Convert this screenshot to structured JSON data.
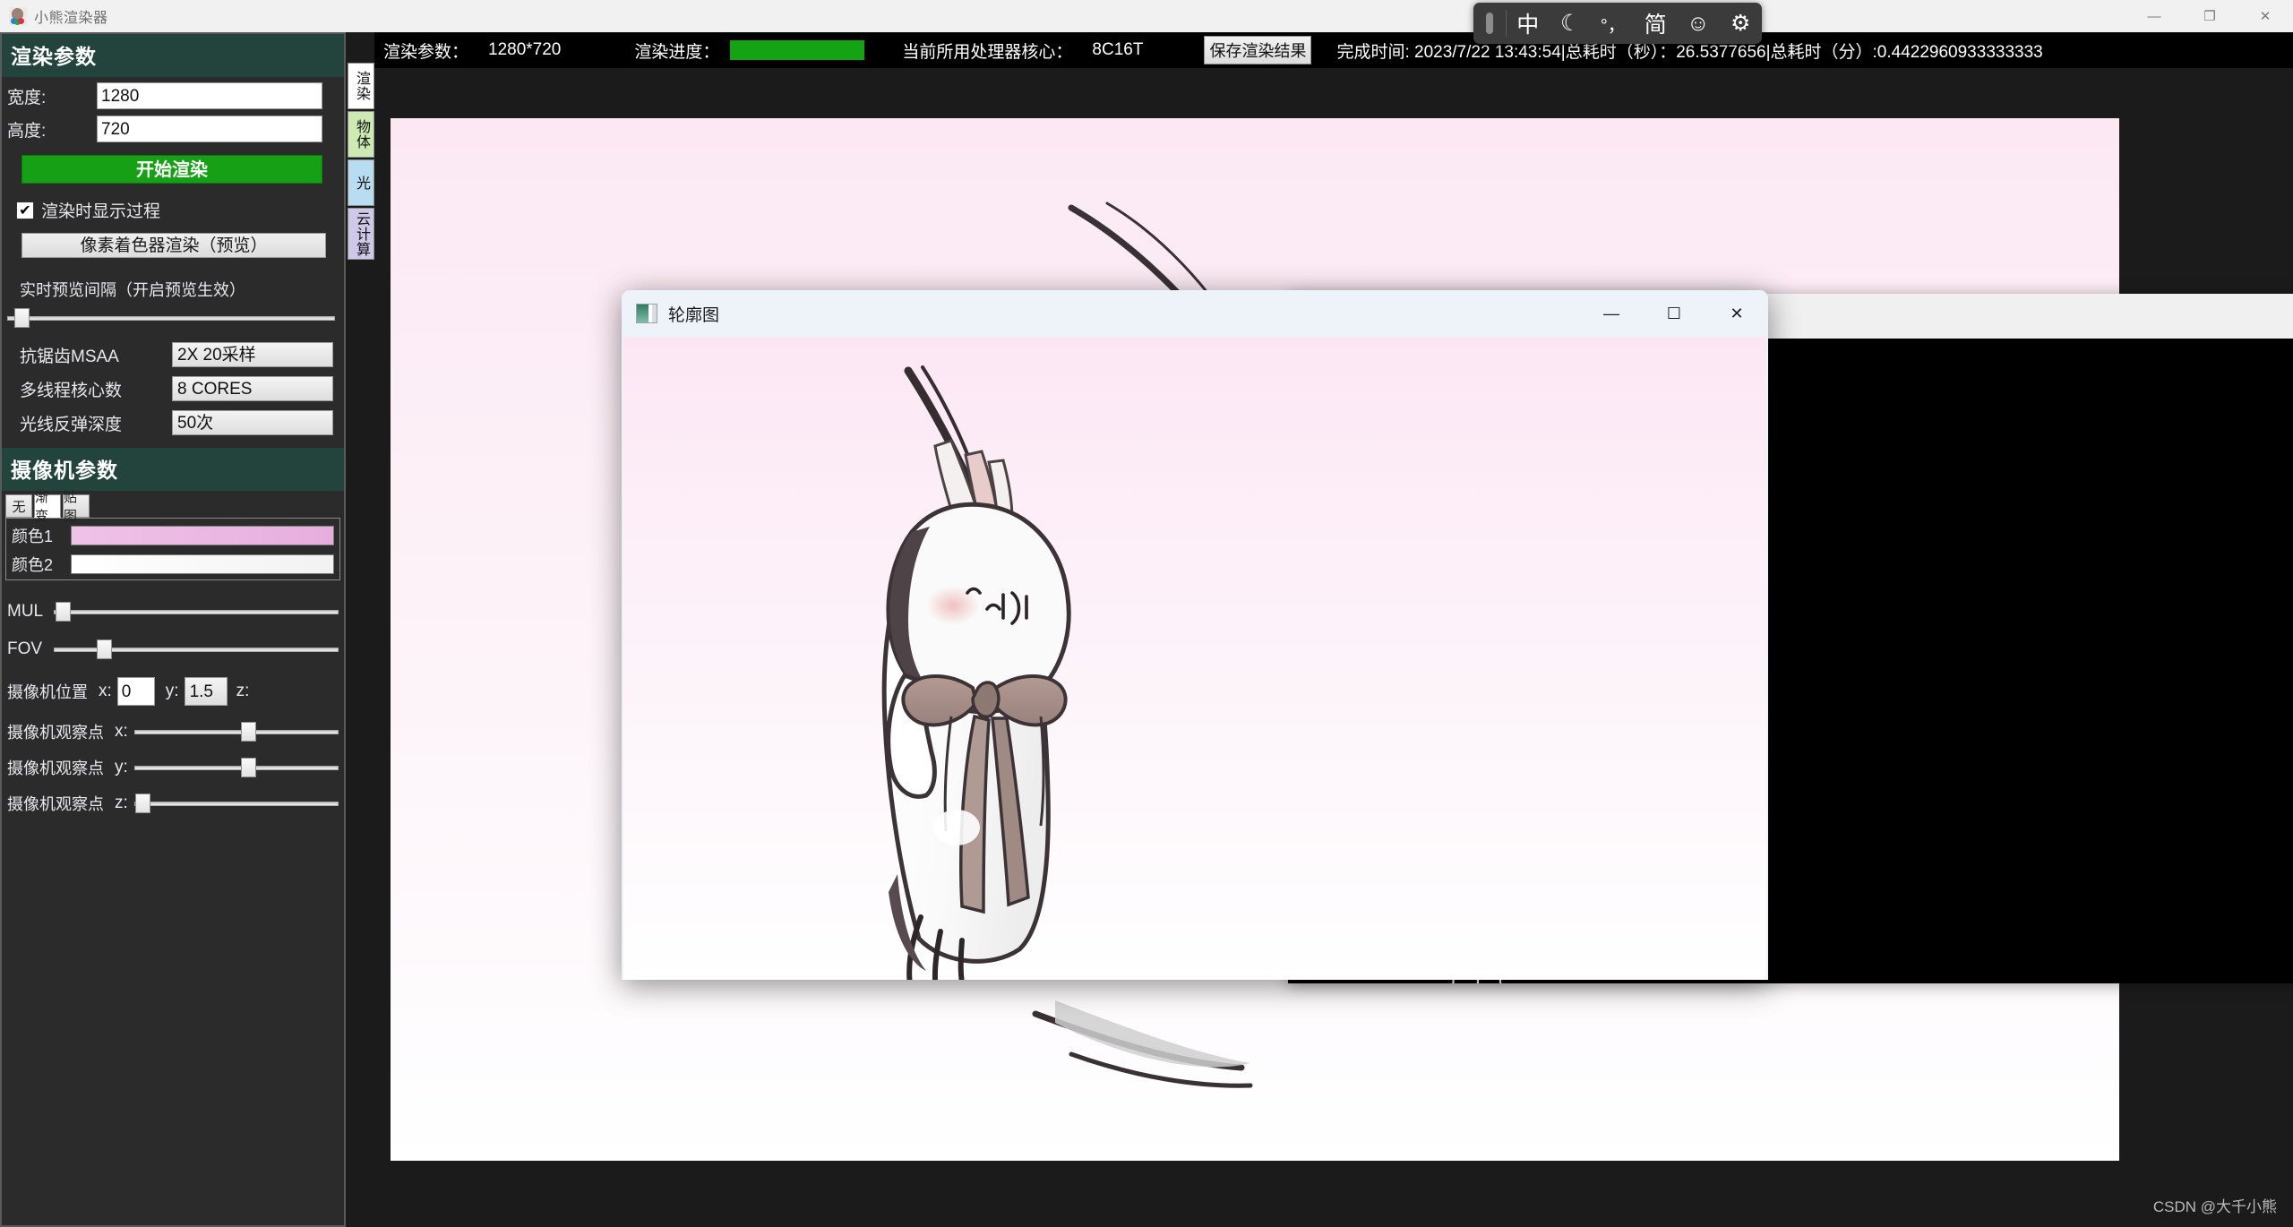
{
  "app": {
    "title": "小熊渲染器",
    "icon": "bear-renderer-icon",
    "window_controls": {
      "minimize": "—",
      "maximize": "❐",
      "close": "✕"
    }
  },
  "sidebar": {
    "render_section": {
      "header": "渲染参数",
      "fields": [
        {
          "label": "宽度:",
          "value": "1280",
          "name": "width-input"
        },
        {
          "label": "高度:",
          "value": "720",
          "name": "height-input"
        }
      ],
      "start_button": "开始渲染",
      "show_process_checkbox": {
        "label": "渲染时显示过程",
        "checked": "✔"
      },
      "pixel_shader_button": "像素着色器渲染（预览）",
      "preview_interval_label": "实时预览间隔（开启预览生效）",
      "combos": [
        {
          "label": "抗锯齿MSAA",
          "value": "2X 20采样"
        },
        {
          "label": "多线程核心数",
          "value": "8 CORES"
        },
        {
          "label": "光线反弹深度",
          "value": "50次"
        }
      ]
    },
    "camera_section": {
      "header": "摄像机参数",
      "tabs": [
        {
          "label": "无",
          "selected": false
        },
        {
          "label": "渐变",
          "selected": true
        },
        {
          "label": "贴图",
          "selected": false
        }
      ],
      "colors": [
        {
          "label": "颜色1",
          "value": "#f0c2e8"
        },
        {
          "label": "颜色2",
          "value": "#ffffff"
        }
      ],
      "sliders": [
        {
          "label": "MUL",
          "pos": 2
        },
        {
          "label": "FOV",
          "pos": 18
        }
      ],
      "camera_position": {
        "label": "摄像机位置",
        "axes": [
          {
            "axis": "x:",
            "value": "0"
          },
          {
            "axis": "y:",
            "value": "1.5"
          },
          {
            "axis": "z:",
            "value": ""
          }
        ]
      },
      "lookat": [
        {
          "label": "摄像机观察点",
          "axis": "x:",
          "pos": 52
        },
        {
          "label": "摄像机观察点",
          "axis": "y:",
          "pos": 52
        },
        {
          "label": "摄像机观察点",
          "axis": "z:",
          "pos": 1
        }
      ]
    }
  },
  "vertical_tabs": [
    {
      "label": "渲染",
      "color": "#ffffff",
      "selected": true
    },
    {
      "label": "物体",
      "color": "#cdeab3",
      "selected": false
    },
    {
      "label": "光",
      "color": "#b8dcf0",
      "selected": false
    },
    {
      "label": "云计算",
      "color": "#cfc8e8",
      "selected": false
    }
  ],
  "statusbar": {
    "render_params_label": "渲染参数：",
    "render_params_value": "1280*720",
    "progress_label": "渲染进度：",
    "progress_percent": 100,
    "cpu_label": "当前所用处理器核心：",
    "cpu_value": "8C16T",
    "save_button": "保存渲染结果",
    "finish_text": "完成时间: 2023/7/22 13:43:54|总耗时（秒）：26.5377656|总耗时（分）:0.4422960933333333"
  },
  "contour_window": {
    "title": "轮廓图",
    "icon": "image-thumb-icon",
    "controls": {
      "minimize": "—",
      "maximize": "☐",
      "close": "✕"
    }
  },
  "background_window": {
    "controls": {
      "minimize": "—",
      "maximize": "☐",
      "close": "✕"
    }
  },
  "ime_toolbar": {
    "items": [
      {
        "name": "ime-mode-chinese",
        "glyph": "中"
      },
      {
        "name": "ime-moon-icon",
        "glyph": "☾"
      },
      {
        "name": "ime-punctuation-icon",
        "glyph": "°，"
      },
      {
        "name": "ime-simplified-icon",
        "glyph": "简"
      },
      {
        "name": "ime-emoji-icon",
        "glyph": "☺"
      },
      {
        "name": "ime-settings-icon",
        "glyph": "⚙"
      }
    ]
  },
  "watermark": "CSDN @大千小熊",
  "theme": {
    "header_green": "#23443c",
    "accent_green": "#15a015",
    "panel_dark": "#2b2b2b",
    "canvas_dark": "#1b1b1b"
  }
}
